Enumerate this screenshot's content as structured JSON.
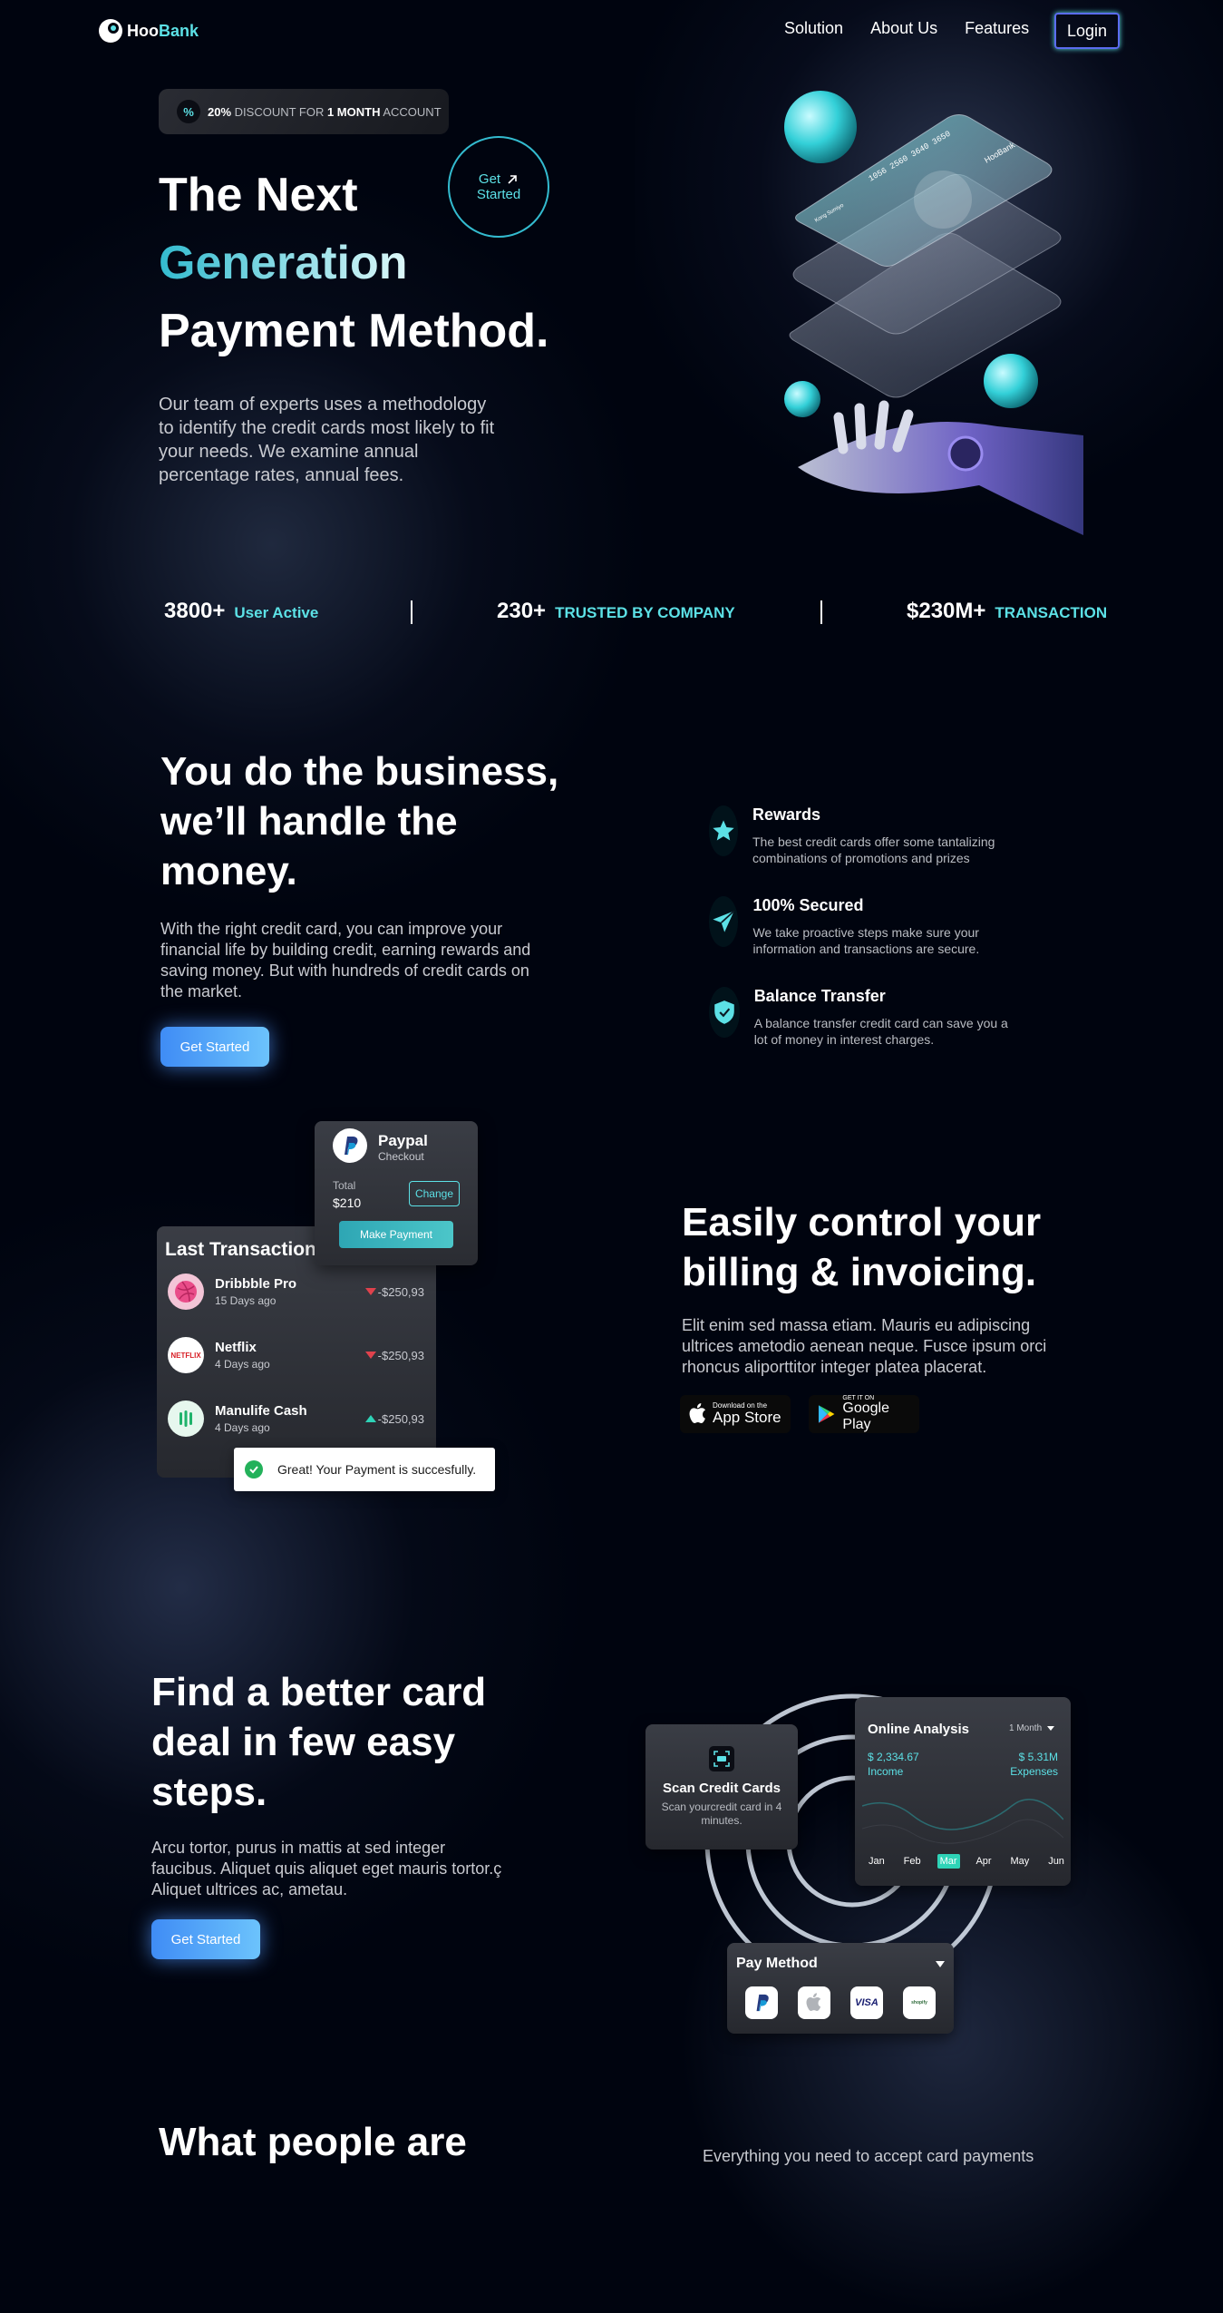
{
  "brand": {
    "name_part1": "Hoo",
    "name_part2": "Bank"
  },
  "nav": {
    "items": [
      "Solution",
      "About Us",
      "Features"
    ],
    "login": "Login"
  },
  "hero": {
    "discount_pct": "20%",
    "discount_mid": " DISCOUNT FOR ",
    "discount_bold": "1 MONTH",
    "discount_end": " ACCOUNT",
    "title_line1": "The Next",
    "title_line2": "Generation",
    "title_line3": "Payment Method.",
    "cta_line1": "Get",
    "cta_line2": "Started",
    "description": "Our team of experts uses a methodology to identify the credit cards most likely to fit your needs. We examine annual percentage rates, annual fees.",
    "card_brand": "HooBank",
    "card_number": "1056 2560 3640 3650",
    "card_holder": "Kong Sumiyo"
  },
  "stats": [
    {
      "value": "3800+",
      "label": "User Active"
    },
    {
      "value": "230+",
      "label": "TRUSTED BY COMPANY"
    },
    {
      "value": "$230M+",
      "label": "TRANSACTION"
    }
  ],
  "business": {
    "title_line1": "You do the business,",
    "title_line2": "we’ll handle the",
    "title_line3": "money.",
    "description": "With the right credit card, you can improve your financial life by building credit, earning rewards and saving money. But with hundreds of credit cards on the market.",
    "button": "Get Started",
    "features": [
      {
        "icon": "star-icon",
        "title": "Rewards",
        "desc": "The best credit cards offer some tantalizing combinations of promotions and prizes"
      },
      {
        "icon": "send-icon",
        "title": "100% Secured",
        "desc": "We take proactive steps make sure your information and transactions are secure."
      },
      {
        "icon": "shield-icon",
        "title": "Balance Transfer",
        "desc": "A balance transfer credit card can save you a lot of money in interest charges."
      }
    ]
  },
  "paypal_card": {
    "title": "Paypal",
    "subtitle": "Checkout",
    "total_label": "Total",
    "total_value": "$210",
    "change": "Change",
    "make_payment": "Make Payment"
  },
  "transactions": {
    "title": "Last Transaction",
    "items": [
      {
        "name": "Dribbble Pro",
        "time": "15 Days ago",
        "amount": "-$250,93",
        "direction": "down"
      },
      {
        "name": "Netflix",
        "time": "4 Days ago",
        "amount": "-$250,93",
        "direction": "down"
      },
      {
        "name": "Manulife Cash",
        "time": "4 Days ago",
        "amount": "-$250,93",
        "direction": "up"
      }
    ],
    "toast": "Great! Your Payment is succesfully."
  },
  "billing": {
    "title_line1": "Easily control your",
    "title_line2": "billing & invoicing.",
    "description": "Elit enim sed massa etiam. Mauris eu adipiscing ultrices ametodio aenean neque. Fusce ipsum orci rhoncus aliporttitor integer platea placerat.",
    "appstore_small": "Download on the",
    "appstore_big": "App Store",
    "googleplay_small": "GET IT ON",
    "googleplay_big": "Google Play"
  },
  "card_deal": {
    "title_line1": "Find a better card",
    "title_line2": "deal in few easy",
    "title_line3": "steps.",
    "description": "Arcu tortor, purus in mattis at sed integer faucibus. Aliquet quis aliquet eget mauris tortor.ç Aliquet ultrices ac, ametau.",
    "button": "Get Started",
    "scan_title": "Scan Credit Cards",
    "scan_desc": "Scan yourcredit card in 4 minutes.",
    "analysis_title": "Online Analysis",
    "analysis_period": "1 Month",
    "income_value": "$ 2,334.67",
    "income_label": "Income",
    "expenses_value": "$ 5.31M",
    "expenses_label": "Expenses",
    "months": [
      "Jan",
      "Feb",
      "Mar",
      "Apr",
      "May",
      "Jun"
    ],
    "active_month": "Mar",
    "pay_title": "Pay Method",
    "pay_icons": [
      "paypal-icon",
      "apple-icon",
      "visa-icon",
      "shopify-icon"
    ],
    "visa_text": "VISA",
    "shopify_text": "shopify"
  },
  "testimonials": {
    "title": "What people are",
    "description": "Everything you need to accept card payments"
  },
  "colors": {
    "accent": "#5ce1e6",
    "background": "#00040f",
    "button": "#3f8cf5"
  }
}
